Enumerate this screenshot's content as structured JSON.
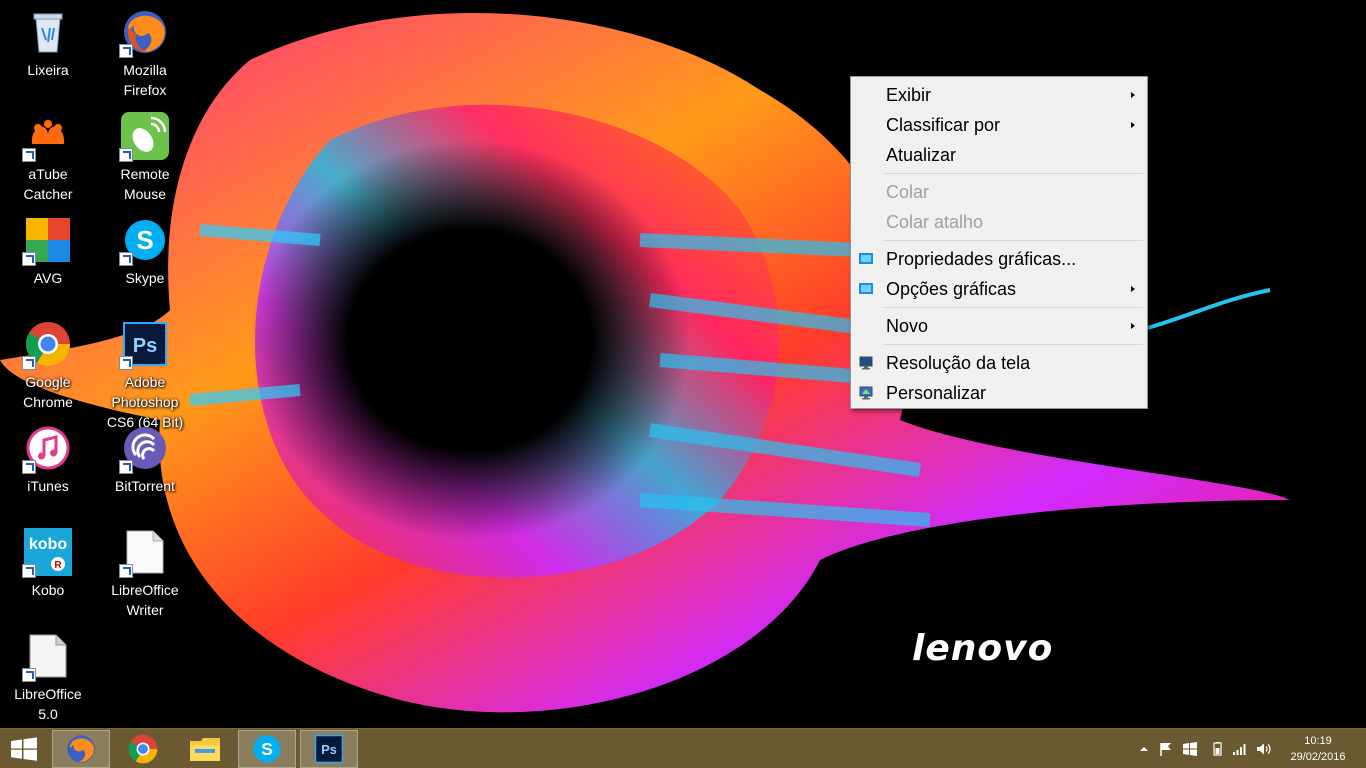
{
  "desktop": {
    "wallpaper_brand": "lenovo",
    "icons": [
      {
        "label": "Lixeira",
        "icon": "recycle-bin-icon"
      },
      {
        "label": "Mozilla\nFirefox",
        "icon": "firefox-icon"
      },
      {
        "label": "aTube\nCatcher",
        "icon": "atube-catcher-icon"
      },
      {
        "label": "Remote\nMouse",
        "icon": "remote-mouse-icon"
      },
      {
        "label": "AVG",
        "icon": "avg-icon"
      },
      {
        "label": "Skype",
        "icon": "skype-icon"
      },
      {
        "label": "Google\nChrome",
        "icon": "chrome-icon"
      },
      {
        "label": "Adobe\nPhotoshop\nCS6 (64 Bit)",
        "icon": "photoshop-icon"
      },
      {
        "label": "iTunes",
        "icon": "itunes-icon"
      },
      {
        "label": "BitTorrent",
        "icon": "bittorrent-icon"
      },
      {
        "label": "Kobo",
        "icon": "kobo-icon"
      },
      {
        "label": "LibreOffice\nWriter",
        "icon": "libreoffice-writer-icon"
      },
      {
        "label": "LibreOffice\n5.0",
        "icon": "libreoffice-icon"
      }
    ]
  },
  "context_menu": {
    "items": [
      {
        "label": "Exibir",
        "submenu": true,
        "disabled": false
      },
      {
        "label": "Classificar por",
        "submenu": true,
        "disabled": false
      },
      {
        "label": "Atualizar",
        "submenu": false,
        "disabled": false
      },
      {
        "label": "Colar",
        "submenu": false,
        "disabled": true
      },
      {
        "label": "Colar atalho",
        "submenu": false,
        "disabled": true
      },
      {
        "label": "Propriedades gráficas...",
        "submenu": false,
        "disabled": false,
        "icon": "intel-graphics-icon"
      },
      {
        "label": "Opções gráficas",
        "submenu": true,
        "disabled": false,
        "icon": "intel-graphics-icon"
      },
      {
        "label": "Novo",
        "submenu": true,
        "disabled": false
      },
      {
        "label": "Resolução da tela",
        "submenu": false,
        "disabled": false,
        "icon": "display-icon"
      },
      {
        "label": "Personalizar",
        "submenu": false,
        "disabled": false,
        "icon": "personalize-icon"
      }
    ]
  },
  "taskbar": {
    "apps": [
      "firefox-icon",
      "chrome-icon",
      "file-explorer-icon",
      "skype-icon",
      "photoshop-icon"
    ],
    "clock": {
      "time": "10:19",
      "date": "29/02/2016"
    },
    "color": "#6b5a31"
  }
}
